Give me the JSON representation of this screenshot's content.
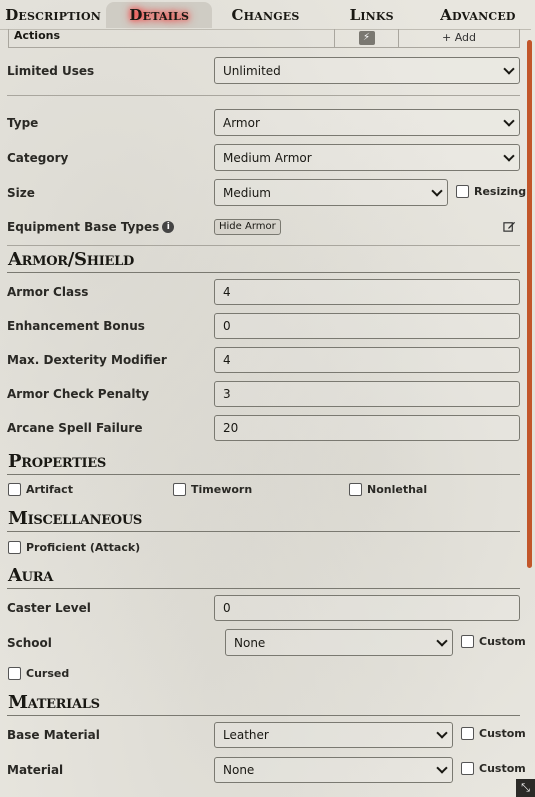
{
  "tabs": [
    {
      "label": "Description",
      "active": false
    },
    {
      "label": "Details",
      "active": true
    },
    {
      "label": "Changes",
      "active": false
    },
    {
      "label": "Links",
      "active": false
    },
    {
      "label": "Advanced",
      "active": false
    }
  ],
  "actions": {
    "label": "Actions",
    "add_label": "+ Add"
  },
  "limited_uses": {
    "label": "Limited Uses",
    "value": "Unlimited"
  },
  "type": {
    "label": "Type",
    "value": "Armor"
  },
  "category": {
    "label": "Category",
    "value": "Medium Armor"
  },
  "size": {
    "label": "Size",
    "value": "Medium",
    "resizing_label": "Resizing",
    "resizing_checked": false
  },
  "equipment_base_types": {
    "label": "Equipment Base Types",
    "tag": "Hide Armor"
  },
  "armor_shield": {
    "heading": "Armor/Shield",
    "armor_class": {
      "label": "Armor Class",
      "value": "4"
    },
    "enhancement_bonus": {
      "label": "Enhancement Bonus",
      "value": "0"
    },
    "max_dex": {
      "label": "Max. Dexterity Modifier",
      "value": "4"
    },
    "acp": {
      "label": "Armor Check Penalty",
      "value": "3"
    },
    "asf": {
      "label": "Arcane Spell Failure",
      "value": "20"
    }
  },
  "properties": {
    "heading": "Properties",
    "artifact": "Artifact",
    "timeworn": "Timeworn",
    "nonlethal": "Nonlethal"
  },
  "misc": {
    "heading": "Miscellaneous",
    "proficient": "Proficient (Attack)"
  },
  "aura": {
    "heading": "Aura",
    "caster_level": {
      "label": "Caster Level",
      "value": "0"
    },
    "school": {
      "label": "School",
      "value": "None",
      "custom_label": "Custom"
    },
    "cursed": "Cursed"
  },
  "materials": {
    "heading": "Materials",
    "base_material": {
      "label": "Base Material",
      "value": "Leather",
      "custom_label": "Custom"
    },
    "material": {
      "label": "Material",
      "value": "None",
      "custom_label": "Custom"
    }
  },
  "colors": {
    "accent_scroll": "#c2562a",
    "tab_glow": "#ff2a2a"
  }
}
